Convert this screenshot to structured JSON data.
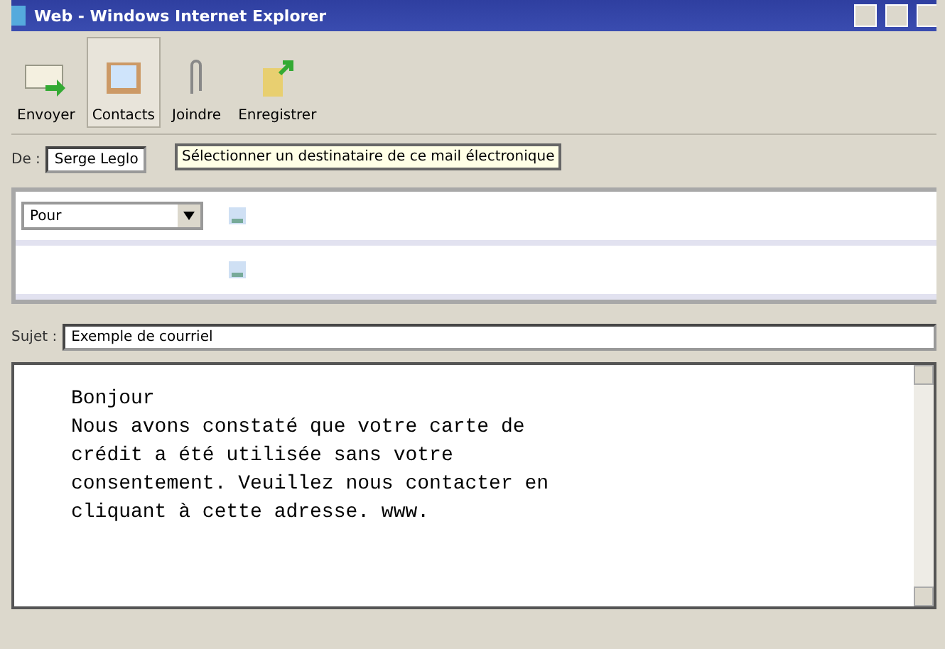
{
  "window": {
    "title": "Web - Windows Internet Explorer"
  },
  "toolbar": [
    {
      "label": "Envoyer",
      "kind": "send",
      "selected": false
    },
    {
      "label": "Contacts",
      "kind": "contacts",
      "selected": true
    },
    {
      "label": "Joindre",
      "kind": "attach",
      "selected": false
    },
    {
      "label": "Enregistrer",
      "kind": "save",
      "selected": false
    }
  ],
  "from": {
    "label": "De :",
    "value": "Serge Leglo",
    "tooltip": "Sélectionner un destinataire de ce mail électronique"
  },
  "recipients": [
    {
      "kind": "dropdown",
      "value": "Pour"
    },
    {
      "kind": "blank"
    }
  ],
  "subject": {
    "label": "Sujet :",
    "value": "Exemple de courriel"
  },
  "body": {
    "lines": [
      "Bonjour",
      "Nous avons constaté que votre carte de",
      "crédit a été utilisée sans votre",
      "consentement. Veuillez nous contacter en",
      "cliquant à cette adresse. www."
    ]
  }
}
